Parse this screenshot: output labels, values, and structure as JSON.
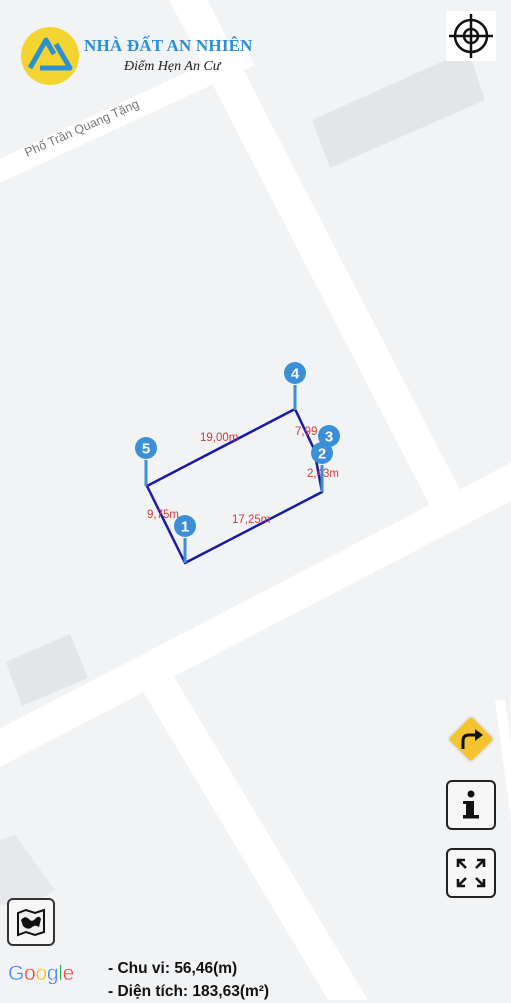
{
  "brand": {
    "name": "NHÀ ĐẤT AN NHIÊN",
    "slogan": "Điểm Hẹn An Cư"
  },
  "map": {
    "street_label": "Phố Trần Quang Tặng",
    "markers": [
      "1",
      "2",
      "3",
      "4",
      "5"
    ],
    "edge_labels": [
      "19,00m",
      "7,99",
      "2,43m",
      "17,25m",
      "9,75m"
    ],
    "colors": {
      "background": "#f2f3f5",
      "road": "#ffffff",
      "block": "#e4e5e8",
      "parcel_outline": "#1a1aa8",
      "measure_text": "#d23a3a",
      "marker": "#3a8fd6"
    }
  },
  "controls": {
    "crosshair": "crosshair-icon",
    "directions": "turn-right-sign-icon",
    "info": "info-icon",
    "fullscreen": "expand-icon",
    "map_type": "map-icon"
  },
  "google_logo": [
    "G",
    "o",
    "o",
    "g",
    "l",
    "e"
  ],
  "google_colors": [
    "#4285f4",
    "#ea4335",
    "#fbbc05",
    "#4285f4",
    "#34a853",
    "#ea4335"
  ],
  "info": {
    "perimeter_label": "- Chu vi:",
    "perimeter_value": "56,46(m)",
    "area_label": "- Diện tích:",
    "area_value": "183,63(m²)"
  }
}
